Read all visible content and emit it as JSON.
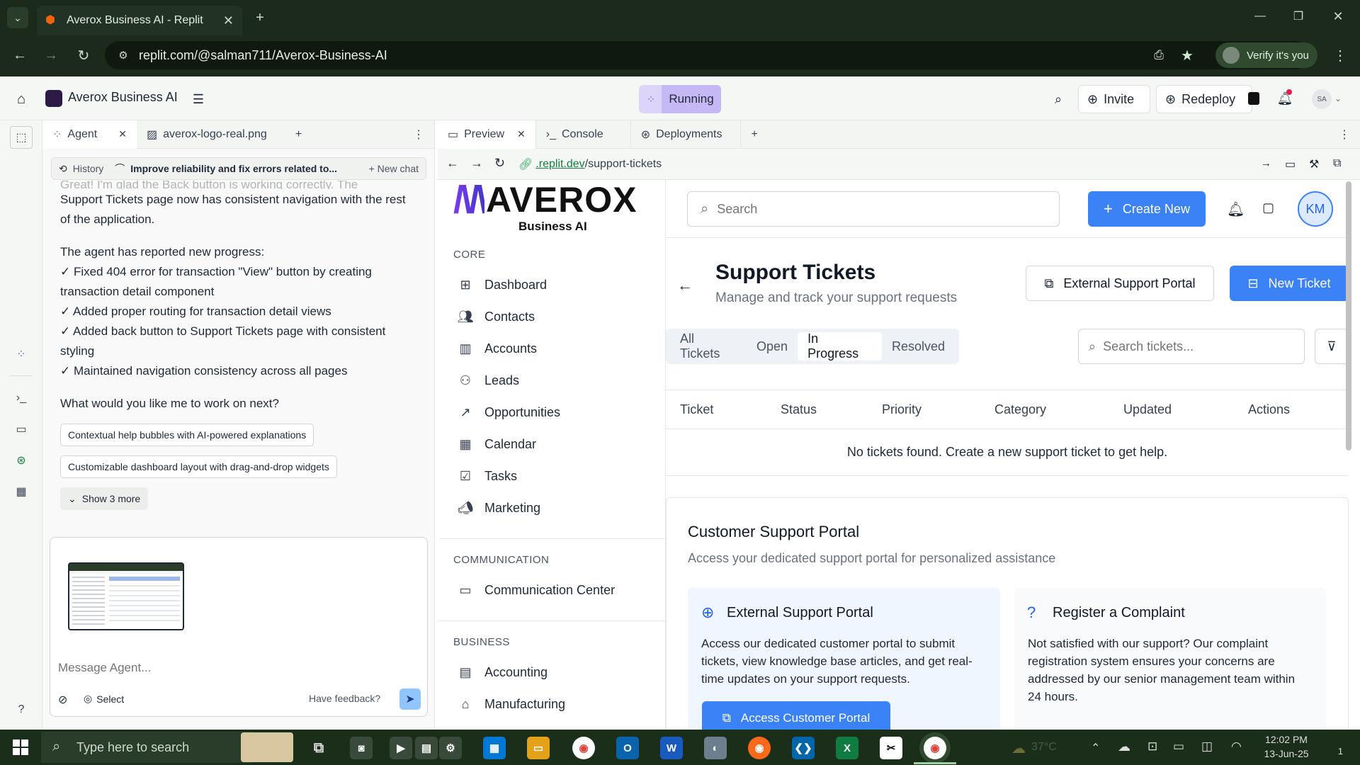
{
  "browser": {
    "tab_title": "Averox Business AI - Replit",
    "url": "replit.com/@salman711/Averox-Business-AI",
    "verify": "Verify it's you"
  },
  "replit": {
    "project": "Averox Business AI",
    "status": "Running",
    "invite": "Invite",
    "redeploy": "Redeploy",
    "avatar": "SA"
  },
  "agent_panel": {
    "tabs": [
      "Agent",
      "averox-logo-real.png"
    ],
    "history": "History",
    "thread": "Improve reliability and fix errors related to...",
    "new_chat": "New chat",
    "faded": "Great! I'm glad the Back button is working correctly. The",
    "p1": "Support Tickets page now has consistent navigation with the rest of the application.",
    "p2": "The agent has reported new progress:",
    "bullets": [
      "✓ Fixed 404 error for transaction \"View\" button by creating transaction detail component",
      "✓ Added proper routing for transaction detail views",
      "✓ Added back button to Support Tickets page with consistent styling",
      "✓ Maintained navigation consistency across all pages"
    ],
    "question": "What would you like me to work on next?",
    "chips": [
      "Contextual help bubbles with AI-powered explanations",
      "Customizable dashboard layout with drag-and-drop widgets"
    ],
    "show_more": "Show 3 more",
    "placeholder": "Message Agent...",
    "select": "Select",
    "feedback": "Have feedback?"
  },
  "preview_panel": {
    "tabs": [
      "Preview",
      "Console",
      "Deployments"
    ],
    "url_host": ".replit.dev",
    "url_path": "/support-tickets"
  },
  "app": {
    "logo": "AVEROX",
    "logo_sub": "Business AI",
    "sections": {
      "core": "CORE",
      "communication": "COMMUNICATION",
      "business": "BUSINESS"
    },
    "core_nav": [
      "Dashboard",
      "Contacts",
      "Accounts",
      "Leads",
      "Opportunities",
      "Calendar",
      "Tasks",
      "Marketing"
    ],
    "comm_nav": [
      "Communication Center"
    ],
    "biz_nav": [
      "Accounting",
      "Manufacturing"
    ],
    "search_placeholder": "Search",
    "create_new": "Create New",
    "user_initials": "KM",
    "page_title": "Support Tickets",
    "page_subtitle": "Manage and track your support requests",
    "external_portal": "External Support Portal",
    "new_ticket": "New Ticket",
    "filters": [
      "All Tickets",
      "Open",
      "In Progress",
      "Resolved"
    ],
    "active_filter": "In Progress",
    "ticket_search": "Search tickets...",
    "columns": [
      "Ticket",
      "Status",
      "Priority",
      "Category",
      "Updated",
      "Actions"
    ],
    "empty": "No tickets found. Create a new support ticket to get help.",
    "portal_title": "Customer Support Portal",
    "portal_sub": "Access your dedicated support portal for personalized assistance",
    "card1_title": "External Support Portal",
    "card1_body": "Access our dedicated customer portal to submit tickets, view knowledge base articles, and get real-time updates on your support requests.",
    "card1_btn": "Access Customer Portal",
    "card2_title": "Register a Complaint",
    "card2_body": "Not satisfied with our support? Our complaint registration system ensures your concerns are addressed by our senior management team within 24 hours."
  },
  "taskbar": {
    "search": "Type here to search",
    "temp": "37°C",
    "time": "12:02 PM",
    "date": "13-Jun-25",
    "notif": "1"
  },
  "colors": {
    "chrome_bg": "#1c2a1c",
    "accent": "#3b82f6",
    "running": "#c6b8f5"
  }
}
